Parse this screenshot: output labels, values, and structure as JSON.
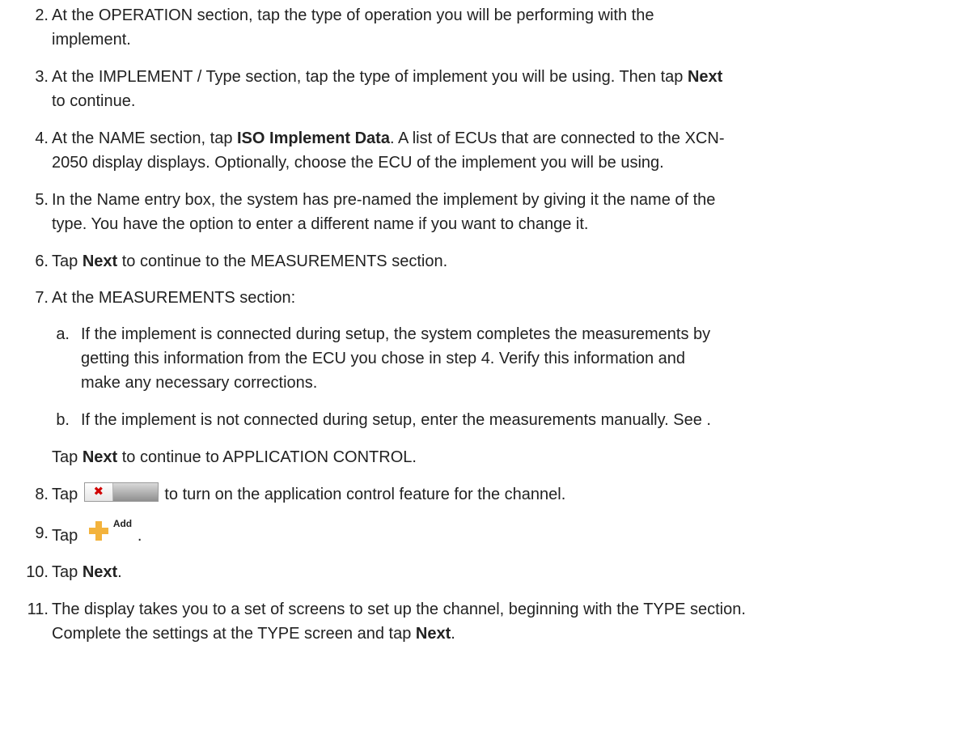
{
  "steps": [
    {
      "n": "2.",
      "line1": "At the OPERATION section, tap the type of operation you will be performing with the",
      "line2": "implement."
    },
    {
      "n": "3.",
      "pre": "At the IMPLEMENT / Type section, tap the type of implement you will be using. Then tap ",
      "bold": "Next",
      "line2": "to continue."
    },
    {
      "n": "4.",
      "pre": "At the NAME section, tap ",
      "bold": "ISO Implement Data",
      "post": ". A list of ECUs that are connected to the XCN-",
      "line2": "2050 display displays. Optionally, choose the ECU of the implement you will be using."
    },
    {
      "n": "5.",
      "line1": "In the Name entry box, the system has pre-named the implement by giving it the name of the",
      "line2": "type. You have the option to enter a different name if you want to change it."
    },
    {
      "n": "6.",
      "pre": "Tap ",
      "bold": "Next",
      "post": " to continue to the MEASUREMENTS section."
    },
    {
      "n": "7.",
      "line1": "At the MEASUREMENTS section:"
    },
    {
      "n": "8.",
      "pre": "Tap ",
      "post": " to turn on the application control feature for the channel."
    },
    {
      "n": "9.",
      "pre": "Tap ",
      "post": "."
    },
    {
      "n": "10.",
      "pre": "Tap ",
      "bold": "Next",
      "post": "."
    },
    {
      "n": "11.",
      "line1": "The display takes you to a set of screens to set up the channel, beginning with the TYPE section.",
      "pre2": "Complete the settings at the TYPE screen and tap ",
      "bold2": "Next",
      "post2": "."
    }
  ],
  "substeps": [
    {
      "n": "a.",
      "line1": "If the implement is connected during setup, the system completes the measurements by",
      "line2": "getting this information from the ECU you chose in step 4. Verify this information and",
      "line3": "make any necessary corrections."
    },
    {
      "n": "b.",
      "line1": "If the implement is not connected during setup, enter the measurements manually. See ."
    }
  ],
  "step7_note": {
    "pre": "Tap ",
    "bold": "Next",
    "post": " to continue to APPLICATION CONTROL."
  },
  "icons": {
    "toggle_mark": "✖",
    "add_label": "Add",
    "accent_color": "#f3b33d",
    "toggle_x_color": "#d00000"
  }
}
